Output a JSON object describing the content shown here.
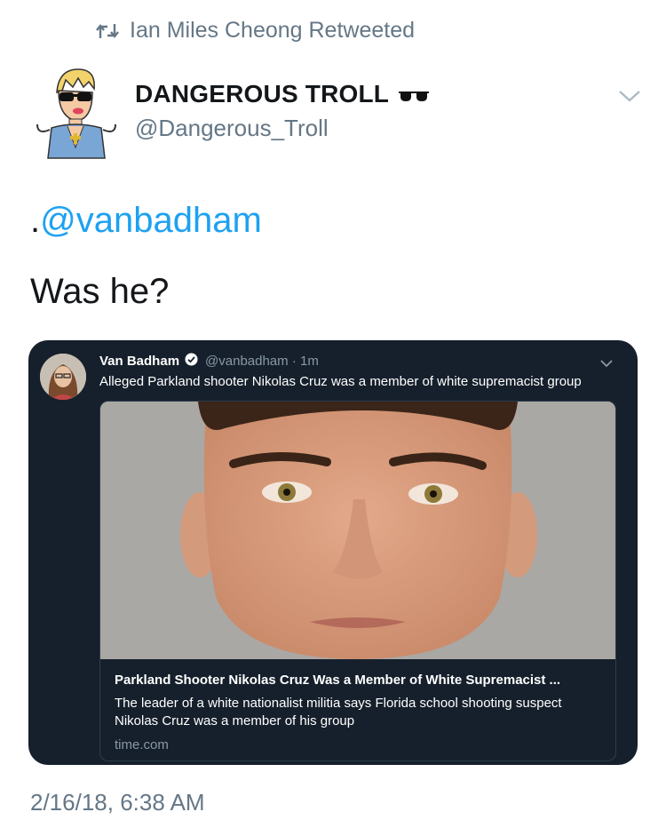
{
  "retweet": {
    "label": "Ian Miles Cheong Retweeted",
    "icon": "retweet-icon"
  },
  "author": {
    "display_name": "DANGEROUS TROLL",
    "emoji_icon": "sunglasses-icon",
    "handle": "@Dangerous_Troll",
    "avatar_icon": "cartoon-avatar-icon"
  },
  "tweet": {
    "mention_prefix": ".",
    "mention": "@vanbadham",
    "text": "Was he?",
    "timestamp": "2/16/18, 6:38 AM"
  },
  "quoted": {
    "name": "Van Badham",
    "handle_time": "@vanbadham · 1m",
    "text": "Alleged Parkland shooter Nikolas Cruz was a member of white supremacist group",
    "card": {
      "title": "Parkland Shooter Nikolas Cruz Was a Member of White Supremacist ...",
      "description": "The leader of a white nationalist militia says Florida school shooting suspect Nikolas Cruz was a member of his group",
      "domain": "time.com"
    }
  },
  "colors": {
    "link": "#1da1f2",
    "secondary_text": "#657786",
    "embed_bg": "#16202c"
  }
}
